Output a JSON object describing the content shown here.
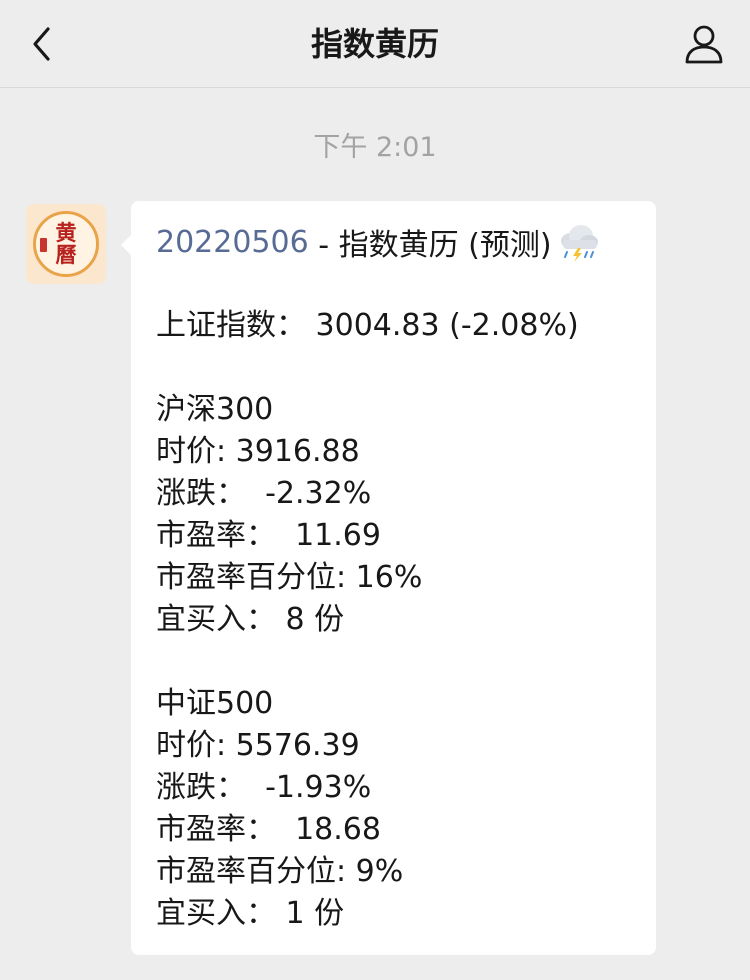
{
  "navbar": {
    "title": "指数黄历"
  },
  "timestamp": "下午 2:01",
  "sender": {
    "avatar_text_top": "黄",
    "avatar_text_bottom": "曆"
  },
  "message": {
    "date_link": "20220506",
    "title_rest": " - 指数黄历 (预测)",
    "weather_icon": "thunderstorm-rain-icon",
    "sse": "上证指数： 3004.83 (-2.08%)",
    "hs300": {
      "name": "沪深300",
      "price": "时价: 3916.88",
      "change": "涨跌：  -2.32%",
      "pe": "市盈率：  11.69",
      "pe_percentile": "市盈率百分位: 16%",
      "buy": "宜买入： 8 份"
    },
    "csi500": {
      "name": "中证500",
      "price": "时价: 5576.39",
      "change": "涨跌：  -1.93%",
      "pe": "市盈率：  18.68",
      "pe_percentile": "市盈率百分位: 9%",
      "buy": "宜买入： 1 份"
    }
  },
  "colors": {
    "background": "#ededed",
    "bubble": "#ffffff",
    "link": "#576b95",
    "text": "#181818",
    "timestamp": "#a3a3a3"
  }
}
